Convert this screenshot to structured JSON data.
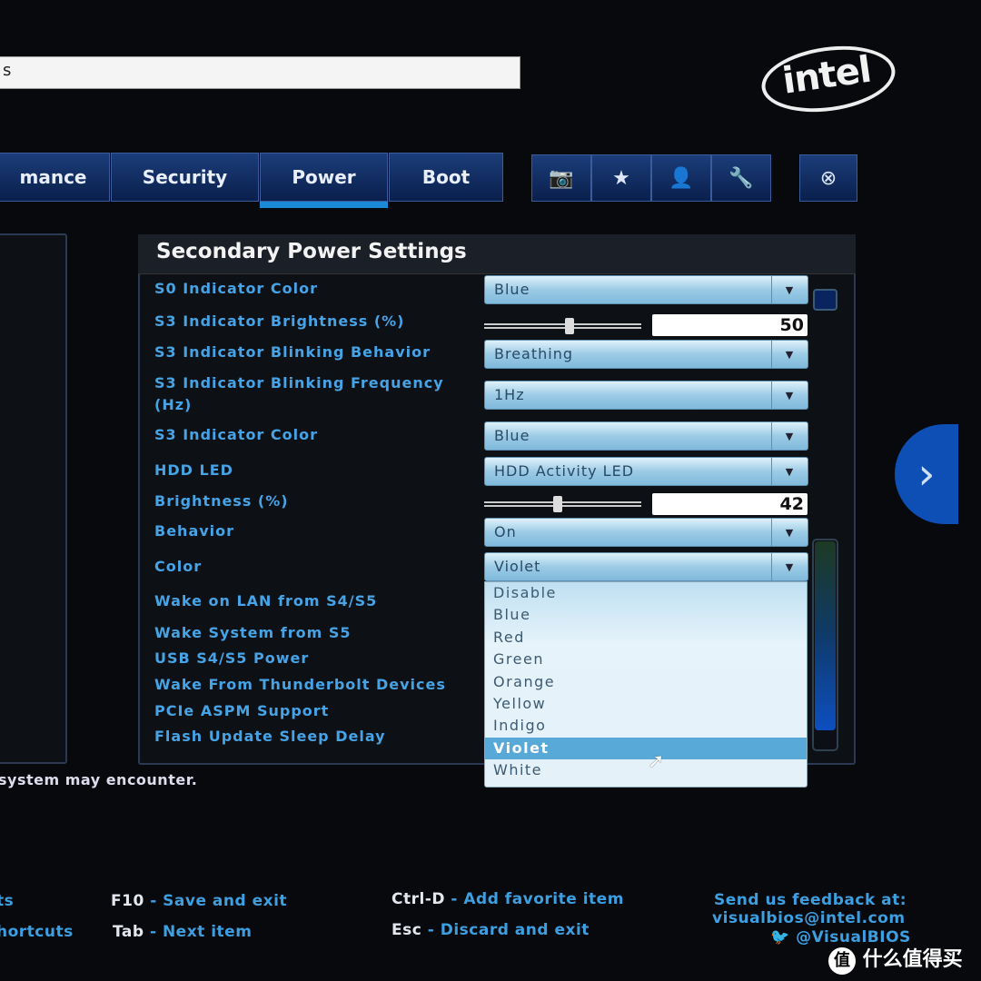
{
  "search": {
    "value": "s"
  },
  "logo": "intel",
  "tabs": [
    {
      "label": "mance"
    },
    {
      "label": "Security"
    },
    {
      "label": "Power",
      "active": true
    },
    {
      "label": "Boot"
    }
  ],
  "icon_buttons": [
    "camera-icon",
    "star-icon",
    "user-icon",
    "wrench-icon"
  ],
  "close_icon": "close-circle-icon",
  "panel": {
    "title": "Secondary Power Settings",
    "rows": [
      {
        "label": "S0 Indicator Color",
        "value": "Blue"
      },
      {
        "label": "S3 Indicator Brightness (%)",
        "value": "50",
        "slider": 50
      },
      {
        "label": "S3 Indicator Blinking Behavior",
        "value": "Breathing"
      },
      {
        "label": "S3 Indicator Blinking Frequency",
        "label2": "(Hz)",
        "value": "1Hz"
      },
      {
        "label": "S3 Indicator Color",
        "value": "Blue"
      },
      {
        "label": "HDD LED",
        "value": "HDD Activity LED"
      },
      {
        "label": "Brightness (%)",
        "value": "42",
        "slider": 42
      },
      {
        "label": "Behavior",
        "value": "On"
      },
      {
        "label": "Color",
        "value": "Violet"
      },
      {
        "label": "Wake on LAN from S4/S5"
      },
      {
        "label": "Wake System from S5"
      },
      {
        "label": "USB S4/S5 Power"
      },
      {
        "label": "Wake From Thunderbolt Devices"
      },
      {
        "label": "PCIe ASPM Support"
      },
      {
        "label": "Flash Update Sleep Delay"
      }
    ],
    "dropdown_options": [
      "Disable",
      "Blue",
      "Red",
      "Green",
      "Orange",
      "Yellow",
      "Indigo",
      "Violet",
      "White"
    ],
    "selected_option": "Violet"
  },
  "help_text": "system may encounter.",
  "footer": {
    "left1": "ts",
    "left2": "hortcuts",
    "f10": {
      "key": "F10",
      "action": "- Save and exit"
    },
    "tab": {
      "key": "Tab",
      "action": "- Next item"
    },
    "ctrld": {
      "key": "Ctrl-D",
      "action": "- Add favorite item"
    },
    "esc": {
      "key": "Esc",
      "action": "- Discard and exit"
    },
    "feedback": "Send us feedback at:",
    "email": "visualbios@intel.com",
    "twitter": "@VisualBIOS"
  },
  "watermark": "什么值得买",
  "colors": {
    "label": "#46a3e6",
    "tab": "#1b3d7a",
    "accent": "#1a8ad8"
  }
}
